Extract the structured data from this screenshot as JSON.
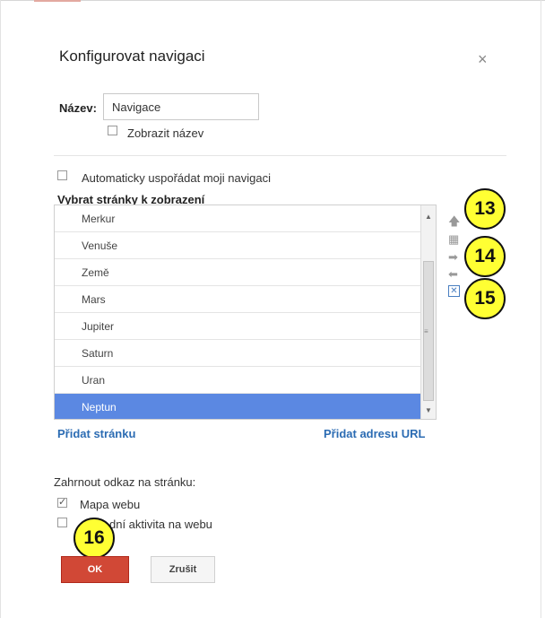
{
  "dialog": {
    "title": "Konfigurovat navigaci",
    "close_glyph": "×",
    "name_label": "Název:",
    "name_value": "Navigace",
    "show_name_label": "Zobrazit název",
    "show_name_checked": false,
    "auto_arrange_label": "Automaticky uspořádat moji navigaci",
    "auto_arrange_checked": false,
    "select_pages_label": "Vybrat stránky k zobrazení",
    "pages": [
      {
        "label": "Merkur",
        "selected": false
      },
      {
        "label": "Venuše",
        "selected": false
      },
      {
        "label": "Země",
        "selected": false
      },
      {
        "label": "Mars",
        "selected": false
      },
      {
        "label": "Jupiter",
        "selected": false
      },
      {
        "label": "Saturn",
        "selected": false
      },
      {
        "label": "Uran",
        "selected": false
      },
      {
        "label": "Neptun",
        "selected": true
      }
    ],
    "add_page_label": "Přidat stránku",
    "add_url_label": "Přidat adresu URL",
    "include_link_label": "Zahrnout odkaz na stránku:",
    "sitemap_label": "Mapa webu",
    "sitemap_checked": true,
    "recent_activity_label": "dní aktivita na webu",
    "recent_activity_checked": false,
    "ok_label": "OK",
    "cancel_label": "Zrušit"
  },
  "side_tools": {
    "icons": [
      "move-up-icon",
      "duplicate-icon",
      "indent-right-icon",
      "outdent-left-icon",
      "remove-icon"
    ]
  },
  "callouts": {
    "b13": "13",
    "b14": "14",
    "b15": "15",
    "b16": "16"
  },
  "colors": {
    "accent_blue": "#5b88e2",
    "link_blue": "#2c6cb3",
    "ok_red": "#d14836",
    "callout_yellow": "#ffff33"
  }
}
